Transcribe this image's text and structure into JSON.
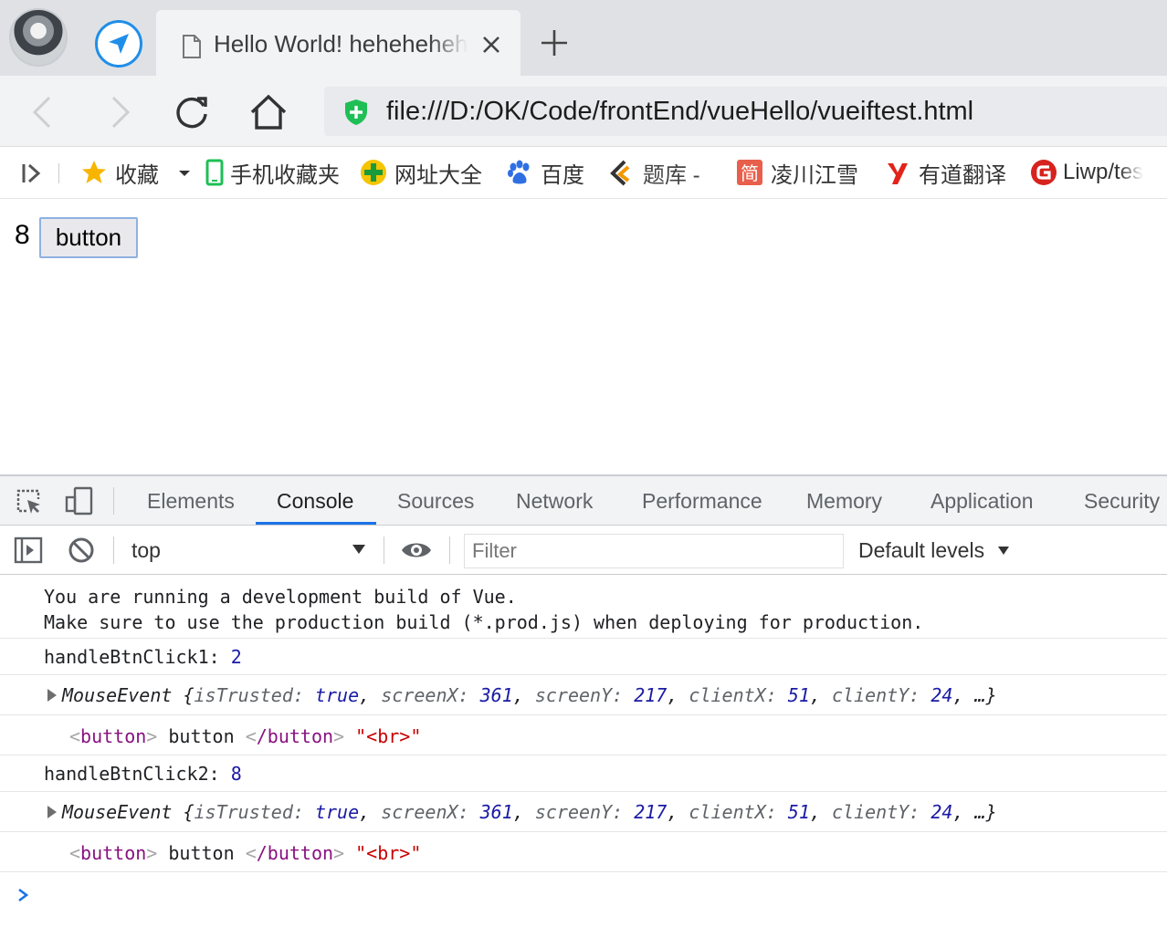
{
  "browser": {
    "tab": {
      "title": "Hello World! hehehehehe"
    },
    "address": {
      "url": "file:///D:/OK/Code/frontEnd/vueHello/vueiftest.html"
    }
  },
  "bookmarks": [
    {
      "label": "收藏",
      "icon": "star-icon"
    },
    {
      "label": "手机收藏夹",
      "icon": "phone-icon"
    },
    {
      "label": "网址大全",
      "icon": "site-directory-icon"
    },
    {
      "label": "百度",
      "icon": "baidu-paw-icon"
    },
    {
      "label": "题库 -",
      "icon": "question-bank-icon"
    },
    {
      "label": "凌川江雪",
      "icon": "jian-icon"
    },
    {
      "label": "有道翻译",
      "icon": "youdao-icon"
    },
    {
      "label": "Liwp/tes",
      "icon": "gitee-icon"
    }
  ],
  "page": {
    "count": "8",
    "button_label": "button"
  },
  "devtools": {
    "tabs": [
      "Elements",
      "Console",
      "Sources",
      "Network",
      "Performance",
      "Memory",
      "Application",
      "Security"
    ],
    "active_tab": "Console",
    "context": "top",
    "filter_placeholder": "Filter",
    "levels": "Default levels",
    "console": {
      "warn_line1": "You are running a development build of Vue.",
      "warn_line2": "Make sure to use the production build (*.prod.js) when deploying for production.",
      "log1_label": "handleBtnClick1: ",
      "log1_value": "2",
      "log2_label": "handleBtnClick2: ",
      "log2_value": "8",
      "event": {
        "name": "MouseEvent",
        "isTrusted": "true",
        "screenX": "361",
        "screenY": "217",
        "clientX": "51",
        "clientY": "24",
        "ellipsis": "…"
      },
      "node": {
        "open_tag": "button",
        "text": "button",
        "close_tag": "/button",
        "extra": "\"<br>\""
      }
    }
  },
  "colors": {
    "accent": "#1a73e8",
    "number": "#1a1aa6",
    "tag": "#881280",
    "string": "#c80000"
  }
}
